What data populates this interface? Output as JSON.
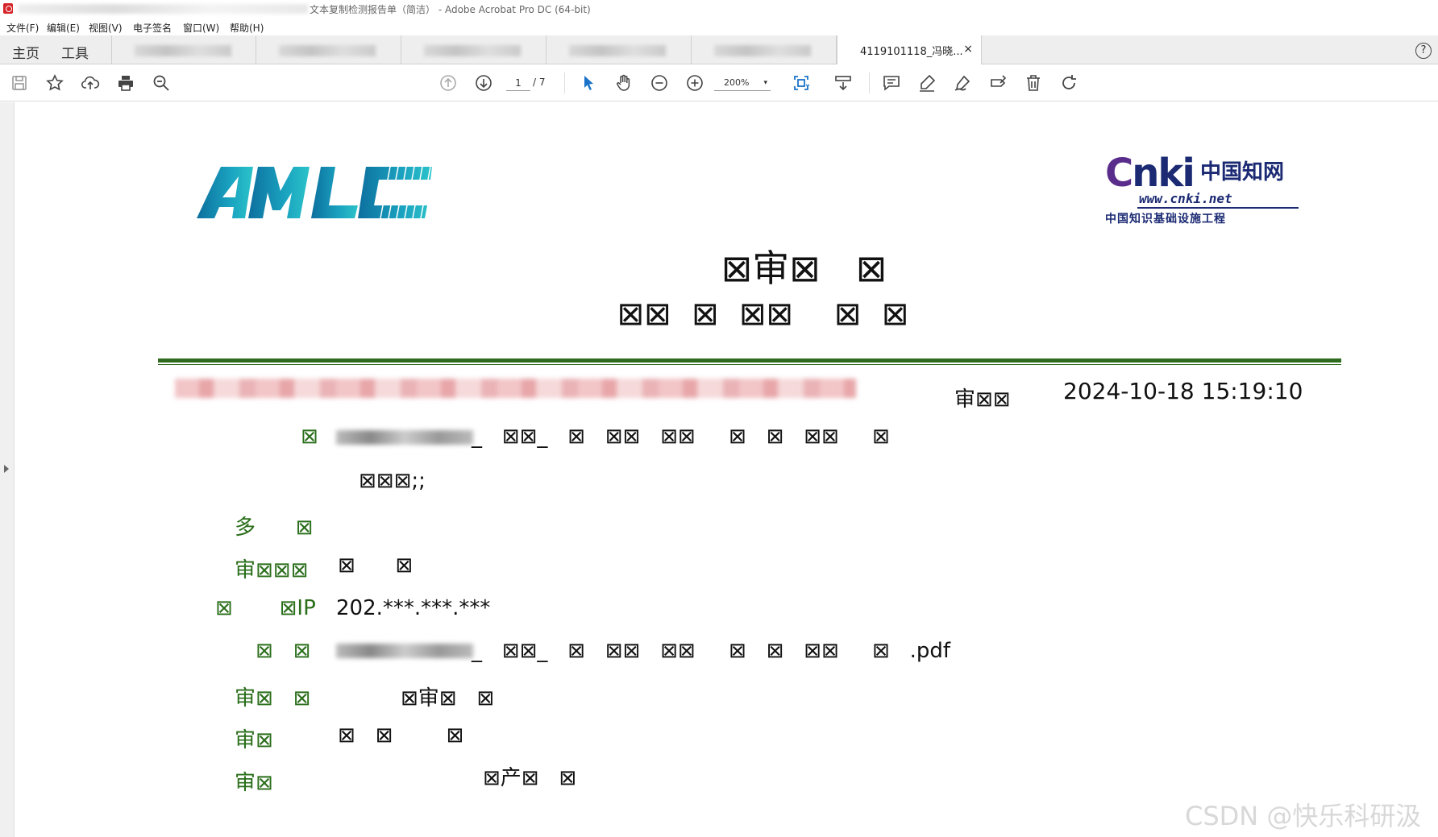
{
  "window": {
    "title": "文本复制检测报告单（简洁） - Adobe Acrobat Pro DC (64-bit)"
  },
  "menu": [
    "文件(F)",
    "编辑(E)",
    "视图(V)",
    "电子签名",
    "窗口(W)",
    "帮助(H)"
  ],
  "tabs": {
    "home": "主页",
    "tools": "工具",
    "active_doc": "4119101118_冯晓...",
    "close_glyph": "×",
    "help_glyph": "?"
  },
  "toolbar": {
    "page_current": "1",
    "page_total": "/ 7",
    "zoom": "200%",
    "zoom_arrow": "▾"
  },
  "icons": [
    "save-icon",
    "bookmark-star-icon",
    "upload-cloud-icon",
    "print-icon",
    "search-zoom-icon",
    "page-up-icon",
    "page-down-icon",
    "select-cursor-icon",
    "hand-icon",
    "zoom-out-icon",
    "zoom-in-icon",
    "fit-page-icon",
    "scroll-mode-icon",
    "comment-icon",
    "highlight-icon",
    "sign-icon",
    "edit-text-icon",
    "delete-icon",
    "undo-icon"
  ],
  "colors": {
    "accent_blue": "#1a73c8",
    "green_text": "#2a6e1a",
    "rule_green": "#2e6b1e"
  },
  "document": {
    "logo_left_text": "AMLC",
    "cnki": {
      "big": "nki",
      "big_c": "C",
      "cn": "中国知网",
      "url": "www.cnki.net",
      "sub": "中国知识基础设施工程"
    },
    "title_line1": "⊠审⊠   ⊠",
    "title_line2": "⊠⊠  ⊠  ⊠⊠    ⊠  ⊠",
    "check_time_label": "审⊠⊠",
    "check_time": "2024-10-18 15:19:10",
    "rows": {
      "r1_label": "⊠",
      "r1_tail": "_   ⊠⊠_   ⊠   ⊠⊠   ⊠⊠     ⊠   ⊠   ⊠⊠     ⊠",
      "r2": "⊠⊠⊠;;",
      "r3_label": "多      ⊠",
      "r4_label": "审⊠⊠⊠",
      "r4_value": "⊠      ⊠",
      "r5_label": "⊠       ⊠IP",
      "r5_value": "202.***.***.***",
      "r6_label": "⊠   ⊠",
      "r6_tail": "_   ⊠⊠_   ⊠   ⊠⊠   ⊠⊠     ⊠   ⊠   ⊠⊠     ⊠   .pdf",
      "r7_label": "审⊠   ⊠",
      "r7_value": "⊠审⊠   ⊠",
      "r8_label": "审⊠",
      "r8_value": "⊠   ⊠        ⊠",
      "r9_label": "审⊠",
      "r9_value": "⊠产⊠   ⊠"
    }
  },
  "watermark": "CSDN @快乐科研汲"
}
